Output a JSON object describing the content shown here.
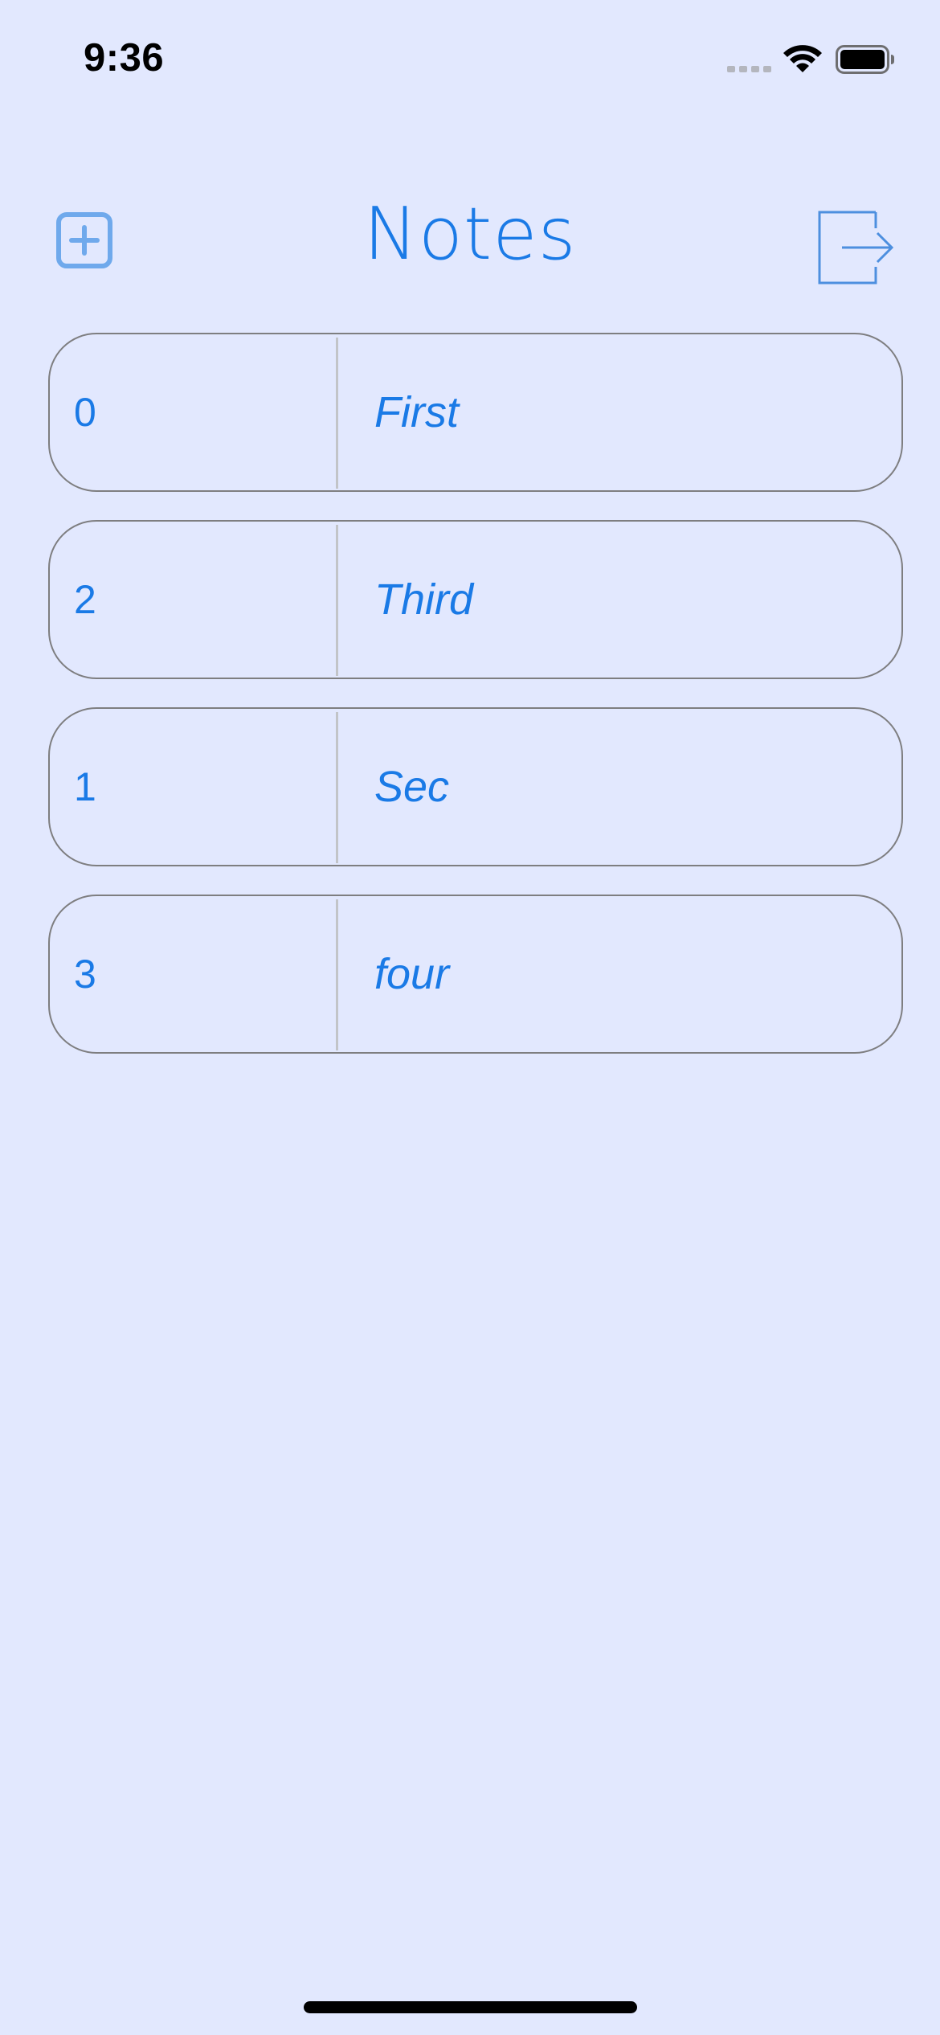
{
  "status_bar": {
    "time": "9:36",
    "icons": [
      "cellular-signal-icon",
      "wifi-icon",
      "battery-icon"
    ]
  },
  "header": {
    "title": "Notes",
    "left_icon": "add-square-icon",
    "right_icon": "logout-icon"
  },
  "notes": [
    {
      "id": "0",
      "title": "First"
    },
    {
      "id": "2",
      "title": "Third"
    },
    {
      "id": "1",
      "title": "Sec"
    },
    {
      "id": "3",
      "title": "four"
    }
  ],
  "colors": {
    "background": "#e2e8fe",
    "accent": "#1a7ae6",
    "icon_blue": "#6fa9ec",
    "row_border": "#7e7e80",
    "divider": "#c2c4c8"
  }
}
